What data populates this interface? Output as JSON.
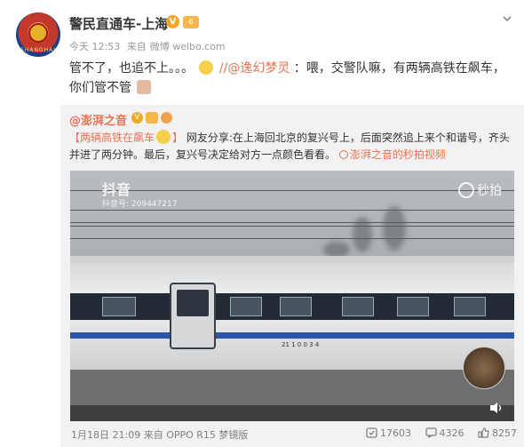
{
  "post": {
    "username": "警民直通车-上海",
    "avatar_text": "SHANGHAI",
    "time": "今天 12:53",
    "source_prefix": "来自",
    "source": "微博 weibo.com",
    "text_part1": "管不了，也追不上。。。",
    "mention": "//@逸幻梦灵",
    "text_part2": "：喂，交警队嘛，有两辆高铁在飙车，",
    "text_part3": "你们管不管"
  },
  "repost": {
    "user": "@澎湃之音",
    "tag": "【两辆高铁在飙车",
    "tag_end": "】",
    "body": "网友分享:在上海回北京的复兴号上，后面突然追上来个和谐号，齐头并进了两分钟。最后，复兴号决定给对方一点颜色看看。",
    "video_link": "澎湃之音的秒拍视频"
  },
  "video": {
    "watermark_logo": "抖音",
    "watermark_id": "抖音号: 209447217",
    "watermark_tag": "秒拍",
    "train_code": "21 1 0 0 3 4"
  },
  "footer": {
    "date": "1月18日 21:09",
    "source_prefix": "来自",
    "source": "OPPO R15 梦镜版",
    "reposts": "17603",
    "comments": "4326",
    "likes": "8257"
  },
  "colors": {
    "accent": "#eb7350",
    "badge": "#f5a623",
    "repost_bg": "#f2f2f5"
  }
}
